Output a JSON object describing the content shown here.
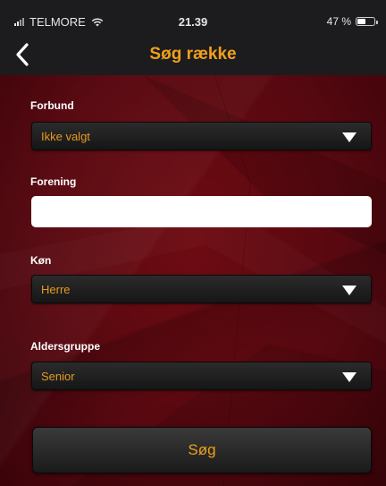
{
  "status_bar": {
    "carrier": "TELMORE",
    "time": "21.39",
    "battery": "47 %",
    "battery_level": 0.47,
    "icons": [
      "signal-icon",
      "wifi-icon",
      "battery-icon"
    ]
  },
  "nav": {
    "title": "Søg række",
    "back_icon": "chevron-left-icon"
  },
  "form": {
    "forbund": {
      "label": "Forbund",
      "value": "Ikke valgt"
    },
    "forening": {
      "label": "Forening",
      "value": "",
      "placeholder": ""
    },
    "koen": {
      "label": "Køn",
      "value": "Herre"
    },
    "aldersgruppe": {
      "label": "Aldersgruppe",
      "value": "Senior"
    },
    "submit_label": "Søg"
  },
  "colors": {
    "accent": "#f0a01c",
    "background": "#580810",
    "bar": "#1c1c1e"
  }
}
